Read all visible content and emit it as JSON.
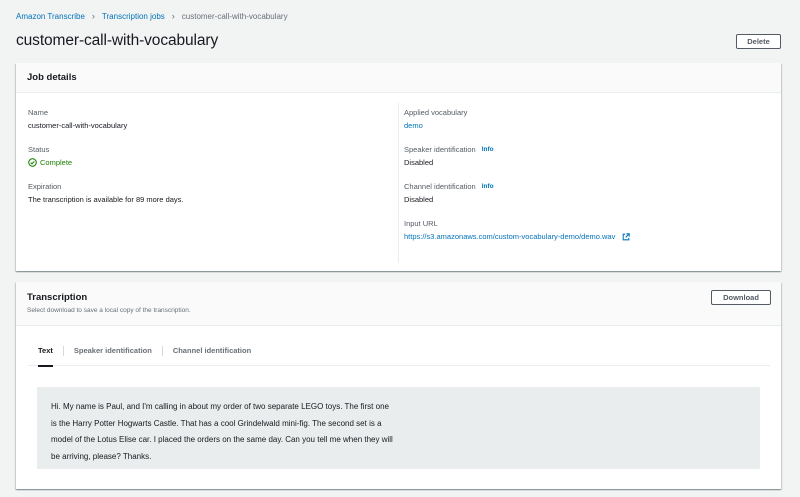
{
  "breadcrumb": {
    "items": [
      "Amazon Transcribe",
      "Transcription jobs"
    ],
    "current": "customer-call-with-vocabulary"
  },
  "header": {
    "title": "customer-call-with-vocabulary",
    "delete_label": "Delete"
  },
  "job_details": {
    "title": "Job details",
    "name_label": "Name",
    "name_value": "customer-call-with-vocabulary",
    "status_label": "Status",
    "status_value": "Complete",
    "expiration_label": "Expiration",
    "expiration_value": "The transcription is available for 89 more days.",
    "vocab_label": "Applied vocabulary",
    "vocab_value": "demo",
    "speaker_label": "Speaker identification",
    "speaker_info": "Info",
    "speaker_value": "Disabled",
    "channel_label": "Channel identification",
    "channel_info": "Info",
    "channel_value": "Disabled",
    "input_label": "Input URL",
    "input_value": "https://s3.amazonaws.com/custom-vocabulary-demo/demo.wav"
  },
  "transcription": {
    "title": "Transcription",
    "description": "Select download to save a local copy of the transcription.",
    "download_label": "Download",
    "tabs": [
      "Text",
      "Speaker identification",
      "Channel identification"
    ],
    "lines": [
      "Hi. My name is Paul, and I'm calling in about my order of two separate LEGO toys. The first one",
      "is the Harry Potter Hogwarts Castle. That has a cool Grindelwald mini-fig. The second set is a",
      "model of the Lotus Elise car. I placed the orders on the same day. Can you tell me when they will",
      "be arriving, please? Thanks."
    ]
  },
  "colors": {
    "link": "#0073bb",
    "success": "#1d8102",
    "background": "#f2f3f3"
  },
  "icons": {
    "status": "check-circle-icon",
    "external": "external-link-icon",
    "separator": "chevron-right-icon"
  }
}
